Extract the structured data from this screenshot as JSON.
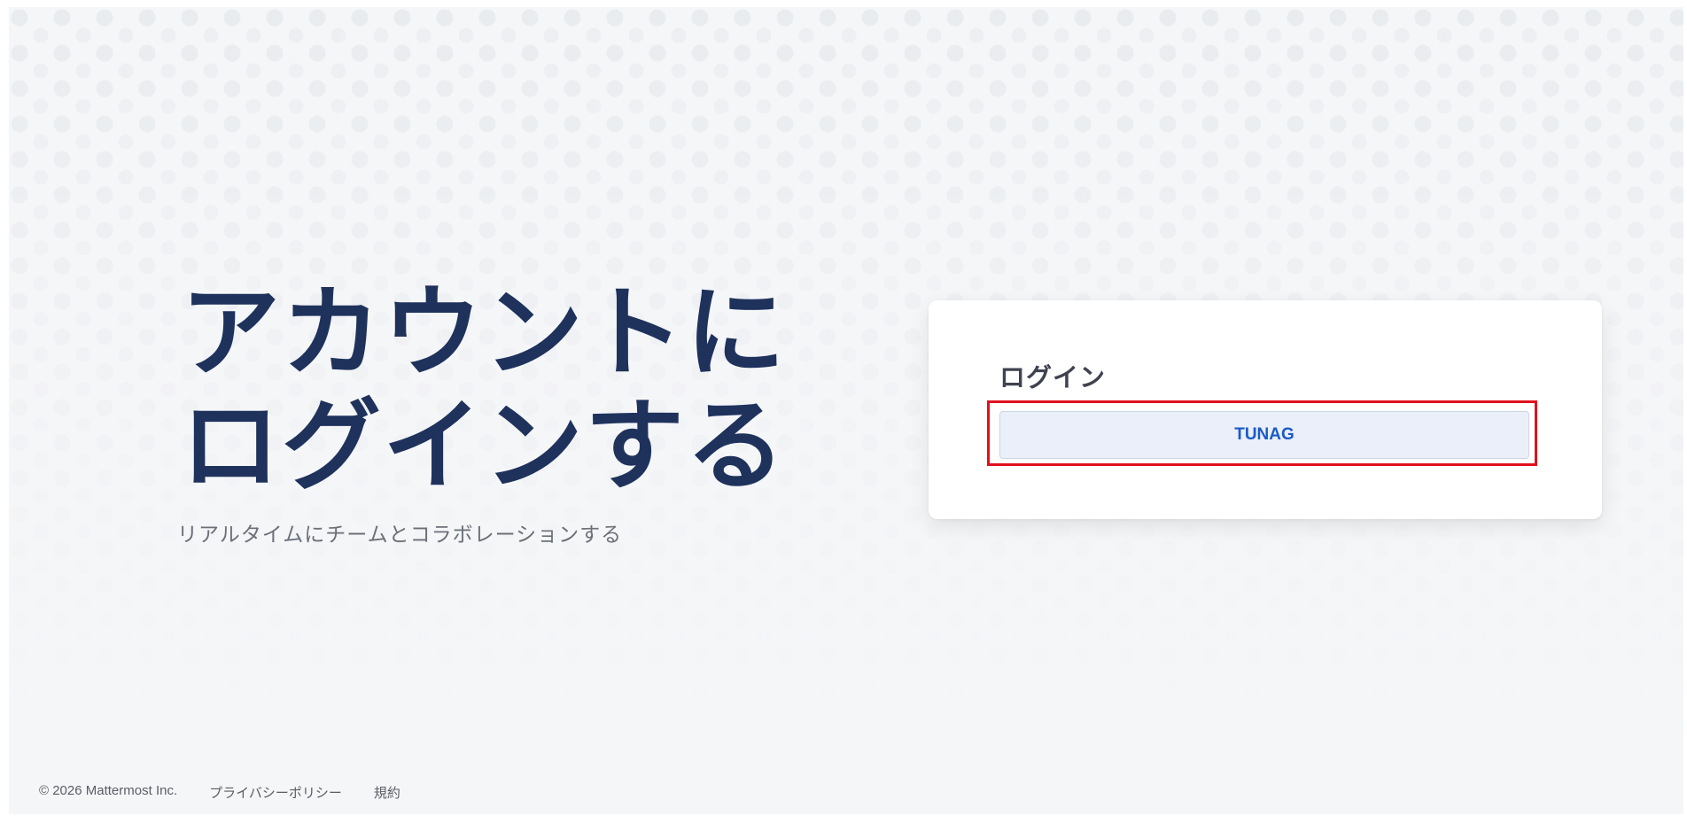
{
  "hero": {
    "title": "アカウントに\nログインする",
    "subtitle": "リアルタイムにチームとコラボレーションする"
  },
  "login": {
    "heading": "ログイン",
    "sso_button_label": "TUNAG"
  },
  "footer": {
    "copyright": "© 2026 Mattermost Inc.",
    "privacy_link": "プライバシーポリシー",
    "terms_link": "規約"
  },
  "colors": {
    "title": "#1e325c",
    "highlight_border": "#e0101e",
    "button_text": "#1a5ac8",
    "button_bg": "#eaeff9"
  }
}
